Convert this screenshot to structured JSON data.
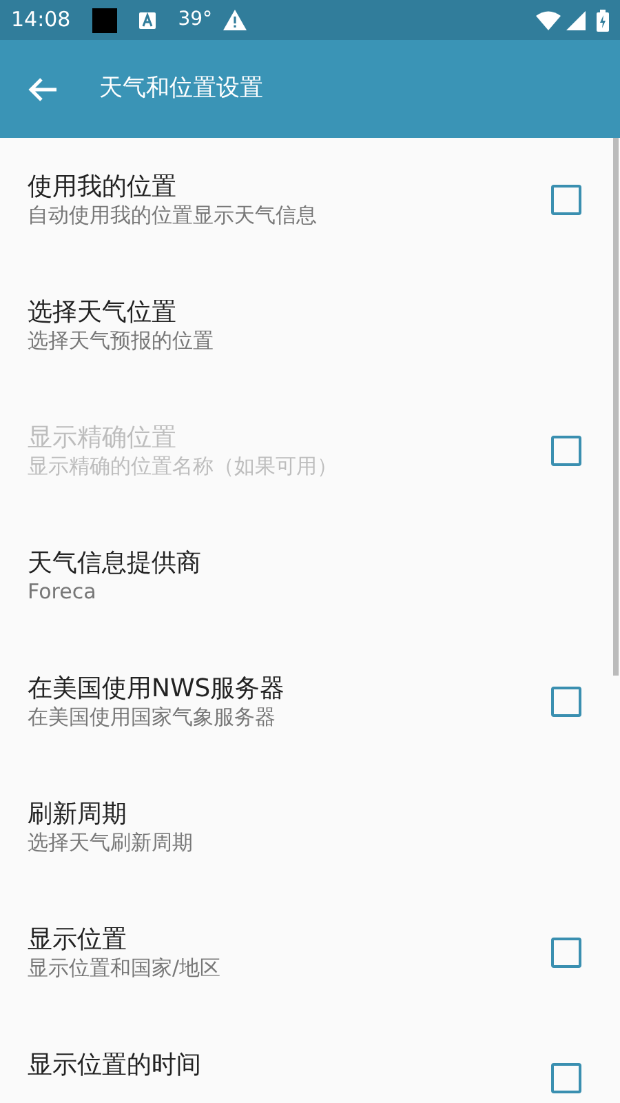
{
  "status_bar": {
    "time": "14:08",
    "temperature": "39°"
  },
  "toolbar": {
    "title": "天气和位置设置"
  },
  "items": [
    {
      "kind": "checkbox",
      "title": "使用我的位置",
      "summary": "自动使用我的位置显示天气信息",
      "checked": false,
      "disabled": false
    },
    {
      "kind": "plain",
      "title": "选择天气位置",
      "summary": "选择天气预报的位置",
      "disabled": false
    },
    {
      "kind": "checkbox",
      "title": "显示精确位置",
      "summary": "显示精确的位置名称（如果可用）",
      "checked": false,
      "disabled": true
    },
    {
      "kind": "plain",
      "title": "天气信息提供商",
      "summary": "Foreca",
      "disabled": false
    },
    {
      "kind": "checkbox",
      "title": "在美国使用NWS服务器",
      "summary": "在美国使用国家气象服务器",
      "checked": false,
      "disabled": false
    },
    {
      "kind": "plain",
      "title": "刷新周期",
      "summary": "选择天气刷新周期",
      "disabled": false
    },
    {
      "kind": "checkbox",
      "title": "显示位置",
      "summary": "显示位置和国家/地区",
      "checked": false,
      "disabled": false
    },
    {
      "kind": "checkbox",
      "title": "显示位置的时间",
      "checked": false,
      "disabled": false
    }
  ]
}
